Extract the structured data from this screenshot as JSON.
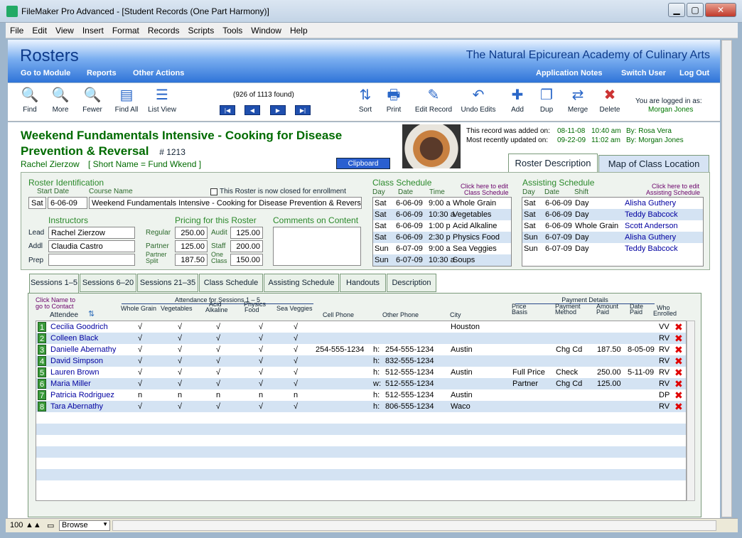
{
  "window": {
    "title": "FileMaker Pro Advanced - [Student Records (One Part Harmony)]"
  },
  "menu": [
    "File",
    "Edit",
    "View",
    "Insert",
    "Format",
    "Records",
    "Scripts",
    "Tools",
    "Window",
    "Help"
  ],
  "header": {
    "title": "Rosters",
    "academy": "The Natural Epicurean Academy of Culinary Arts",
    "links_left": [
      "Go to Module",
      "Reports",
      "Other Actions"
    ],
    "links_right": [
      "Application Notes",
      "Switch User",
      "Log Out"
    ]
  },
  "toolbar": {
    "found": "(926 of 1113 found)",
    "buttons": [
      "Find",
      "More",
      "Fewer",
      "Find All",
      "List View",
      "Sort",
      "Print",
      "Edit Record",
      "Undo Edits",
      "Add",
      "Dup",
      "Merge",
      "Delete"
    ],
    "logged_label": "You are logged in as:",
    "user": "Morgan Jones"
  },
  "record": {
    "title": "Weekend Fundamentals Intensive - Cooking for Disease Prevention & Reversal",
    "num": "# 1213",
    "instructor_line": "Rachel Zierzow",
    "short_name": "[ Short Name = Fund Wkend ]",
    "clipboard": "Clipboard",
    "added_label": "This record was added on:",
    "added_date": "08-11-08",
    "added_time": "10:40 am",
    "added_by": "By: Rosa Vera",
    "updated_label": "Most recently updated on:",
    "updated_date": "09-22-09",
    "updated_time": "11:02 am",
    "updated_by": "By: Morgan Jones"
  },
  "top_tabs": [
    "Roster Description",
    "Map of Class Location"
  ],
  "roster_id": {
    "label": "Roster Identification",
    "start_date_label": "Start Date",
    "course_label": "Course Name",
    "closed_label": "This Roster is now closed for enrollment",
    "day": "Sat",
    "date": "6-06-09",
    "course": "Weekend Fundamentals Intensive - Cooking for Disease Prevention & Reversal"
  },
  "instructors": {
    "label": "Instructors",
    "lead_label": "Lead",
    "lead": "Rachel Zierzow",
    "addl_label": "Addl",
    "addl": "Claudia Castro",
    "prep_label": "Prep",
    "prep": ""
  },
  "pricing": {
    "label": "Pricing for this Roster",
    "regular_label": "Regular",
    "regular": "250.00",
    "audit_label": "Audit",
    "audit": "125.00",
    "partner_label": "Partner",
    "partner": "125.00",
    "staff_label": "Staff",
    "staff": "200.00",
    "split_label_1": "Partner",
    "split_label_2": "Split",
    "split": "187.50",
    "oneclass_label_1": "One",
    "oneclass_label_2": "Class",
    "oneclass": "150.00"
  },
  "comments": {
    "label": "Comments on Content"
  },
  "class_schedule": {
    "label": "Class Schedule",
    "edit1": "Click here to edit",
    "edit2": "Class Schedule",
    "cols": [
      "Day",
      "Date",
      "Time"
    ],
    "rows": [
      [
        "Sat",
        "6-06-09",
        "9:00 a",
        "Whole Grain"
      ],
      [
        "Sat",
        "6-06-09",
        "10:30 a",
        "Vegetables"
      ],
      [
        "Sat",
        "6-06-09",
        "1:00 p",
        "Acid Alkaline"
      ],
      [
        "Sat",
        "6-06-09",
        "2:30 p",
        "Physics Food"
      ],
      [
        "Sun",
        "6-07-09",
        "9:00 a",
        "Sea Veggies"
      ],
      [
        "Sun",
        "6-07-09",
        "10:30 a",
        "Soups"
      ]
    ]
  },
  "assisting_schedule": {
    "label": "Assisting Schedule",
    "edit1": "Click here to edit",
    "edit2": "Assisting Schedule",
    "cols": [
      "Day",
      "Date",
      "Shift"
    ],
    "rows": [
      [
        "Sat",
        "6-06-09",
        "Day",
        "Alisha Guthery"
      ],
      [
        "Sat",
        "6-06-09",
        "Day",
        "Teddy Babcock"
      ],
      [
        "Sat",
        "6-06-09",
        "Whole Grain",
        "Scott Anderson"
      ],
      [
        "Sun",
        "6-07-09",
        "Day",
        "Alisha Guthery"
      ],
      [
        "Sun",
        "6-07-09",
        "Day",
        "Teddy Babcock"
      ]
    ]
  },
  "bottom_tabs": [
    "Sessions 1–5",
    "Sessions 6–20",
    "Sessions 21–35",
    "Class Schedule",
    "Assisting Schedule",
    "Handouts",
    "Description"
  ],
  "sessions": {
    "click1": "Click Name to",
    "click2": "go to Contact",
    "attendee": "Attendee",
    "attendance_label": "Attendance for Sessions 1 – 5",
    "payment_label": "Payment Details",
    "cols": {
      "s1": "Whole Grain",
      "s2": "Vegetables",
      "s3a": "Acid",
      "s3b": "Alkaline",
      "s4a": "Physics",
      "s4b": "Food",
      "s5": "Sea Veggies",
      "cell": "Cell Phone",
      "other": "Other Phone",
      "city": "City",
      "price1": "Price",
      "price2": "Basis",
      "pm1": "Payment",
      "pm2": "Method",
      "amt1": "Amount",
      "amt2": "Paid",
      "dp1": "Date",
      "dp2": "Paid",
      "who1": "Who",
      "who2": "Enrolled"
    },
    "rows": [
      {
        "n": "1",
        "name": "Cecilia Goodrich",
        "a": [
          "√",
          "√",
          "√",
          "√",
          "√"
        ],
        "cell": "",
        "pt": "",
        "phone": "",
        "city": "Houston",
        "basis": "",
        "method": "",
        "amt": "",
        "date": "",
        "who": "VV"
      },
      {
        "n": "2",
        "name": "Colleen Black",
        "a": [
          "√",
          "√",
          "√",
          "√",
          "√"
        ],
        "cell": "",
        "pt": "",
        "phone": "",
        "city": "",
        "basis": "",
        "method": "",
        "amt": "",
        "date": "",
        "who": "RV"
      },
      {
        "n": "3",
        "name": "Danielle Abernathy",
        "a": [
          "√",
          "√",
          "√",
          "√",
          "√"
        ],
        "cell": "254-555-1234",
        "pt": "h:",
        "phone": "254-555-1234",
        "city": "Austin",
        "basis": "",
        "method": "Chg Cd",
        "amt": "187.50",
        "date": "8-05-09",
        "who": "RV"
      },
      {
        "n": "4",
        "name": "David Simpson",
        "a": [
          "√",
          "√",
          "√",
          "√",
          "√"
        ],
        "cell": "",
        "pt": "h:",
        "phone": "832-555-1234",
        "city": "",
        "basis": "",
        "method": "",
        "amt": "",
        "date": "",
        "who": "RV"
      },
      {
        "n": "5",
        "name": "Lauren Brown",
        "a": [
          "√",
          "√",
          "√",
          "√",
          "√"
        ],
        "cell": "",
        "pt": "h:",
        "phone": "512-555-1234",
        "city": "Austin",
        "basis": "Full Price",
        "method": "Check",
        "amt": "250.00",
        "date": "5-11-09",
        "who": "RV"
      },
      {
        "n": "6",
        "name": "Maria Miller",
        "a": [
          "√",
          "√",
          "√",
          "√",
          "√"
        ],
        "cell": "",
        "pt": "w:",
        "phone": "512-555-1234",
        "city": "",
        "basis": "Partner",
        "method": "Chg Cd",
        "amt": "125.00",
        "date": "",
        "who": "RV"
      },
      {
        "n": "7",
        "name": "Patricia Rodriguez",
        "a": [
          "n",
          "n",
          "n",
          "n",
          "n"
        ],
        "cell": "",
        "pt": "h:",
        "phone": "512-555-1234",
        "city": "Austin",
        "basis": "",
        "method": "",
        "amt": "",
        "date": "",
        "who": "DP"
      },
      {
        "n": "8",
        "name": "Tara Abernathy",
        "a": [
          "√",
          "√",
          "√",
          "√",
          "√"
        ],
        "cell": "",
        "pt": "h:",
        "phone": "806-555-1234",
        "city": "Waco",
        "basis": "",
        "method": "",
        "amt": "",
        "date": "",
        "who": "RV"
      }
    ]
  },
  "status": {
    "zoom": "100",
    "mode": "Browse"
  }
}
